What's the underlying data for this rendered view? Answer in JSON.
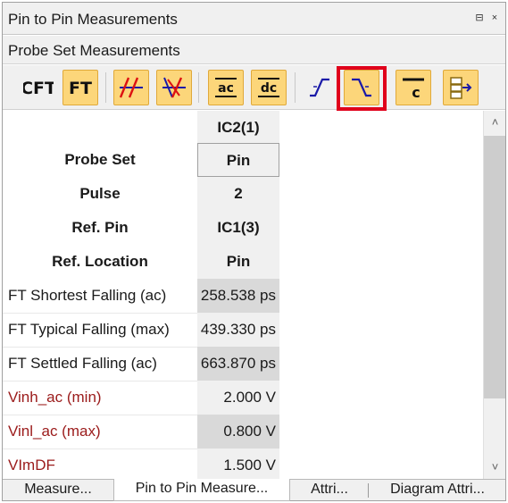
{
  "window": {
    "title": "Pin to Pin Measurements",
    "pin_glyph": "⊟",
    "close_glyph": "×"
  },
  "panel": {
    "subtitle": "Probe Set Measurements"
  },
  "toolbar": {
    "buttons": [
      {
        "name": "cft",
        "label": "CFT",
        "state": "off",
        "icon": "cft-text-icon"
      },
      {
        "name": "ft",
        "label": "FT",
        "state": "on",
        "icon": "ft-text-icon"
      },
      {
        "name": "rising-edges",
        "state": "on",
        "icon": "rising-edges-icon"
      },
      {
        "name": "falling-edges",
        "state": "on",
        "icon": "falling-edges-icon"
      },
      {
        "name": "ac",
        "label": "ac",
        "state": "on",
        "icon": "ac-threshold-icon"
      },
      {
        "name": "dc",
        "label": "dc",
        "state": "on",
        "icon": "dc-threshold-icon"
      },
      {
        "name": "rising-edge",
        "state": "off",
        "icon": "rising-edge-icon"
      },
      {
        "name": "falling-edge",
        "state": "on",
        "highlighted": true,
        "icon": "falling-edge-icon"
      },
      {
        "name": "c-threshold",
        "label": "c",
        "state": "on",
        "icon": "c-threshold-icon"
      },
      {
        "name": "export",
        "state": "on",
        "icon": "export-icon"
      }
    ],
    "highlight_color": "#e0001b",
    "active_color": "#fcd67a"
  },
  "table": {
    "column_header": "IC2(1)",
    "rows": [
      {
        "label": "Probe Set",
        "value": "Pin"
      },
      {
        "label": "Pulse",
        "value": "2"
      },
      {
        "label": "Ref. Pin",
        "value": "IC1(3)"
      },
      {
        "label": "Ref. Location",
        "value": "Pin"
      },
      {
        "label": "FT Shortest Falling (ac)",
        "value": "258.538 ps"
      },
      {
        "label": "FT Typical Falling (max)",
        "value": "439.330 ps"
      },
      {
        "label": "FT Settled Falling (ac)",
        "value": "663.870 ps"
      },
      {
        "label": "Vinh_ac (min)",
        "value": "2.000 V"
      },
      {
        "label": "Vinl_ac (max)",
        "value": "0.800 V"
      },
      {
        "label": "VImDF",
        "value": "1.500 V"
      }
    ],
    "label_color_red": "#9b1b1b"
  },
  "scrollbar": {
    "up_glyph": "˄",
    "down_glyph": "˅"
  },
  "tabs": [
    {
      "label": "Measure...",
      "active": false
    },
    {
      "label": "Pin to Pin Measure...",
      "active": true
    },
    {
      "label": "Attri...",
      "active": false
    },
    {
      "label": "Diagram Attri...",
      "active": false
    }
  ]
}
